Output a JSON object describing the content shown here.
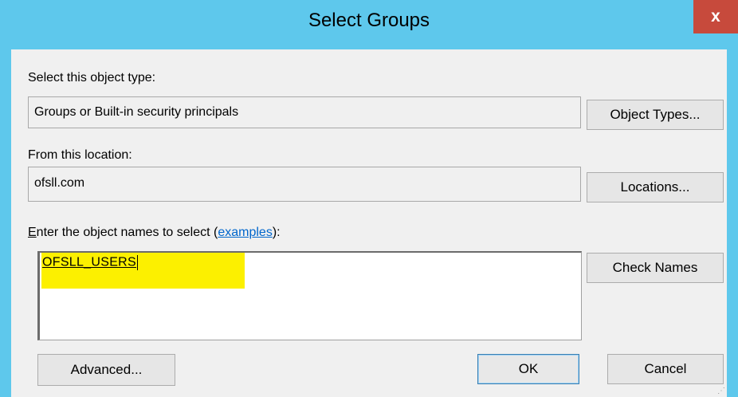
{
  "window": {
    "title": "Select Groups",
    "close_glyph": "x"
  },
  "object_type": {
    "label": "Select this object type:",
    "value": "Groups or Built-in security principals",
    "button": "Object Types..."
  },
  "location": {
    "label": "From this location:",
    "value": "ofsll.com",
    "button": "Locations..."
  },
  "names": {
    "label_prefix": "nter the object names to select (",
    "label_accel": "E",
    "link": "examples",
    "label_suffix": "):",
    "value": "OFSLL_USERS",
    "button": "Check Names"
  },
  "footer": {
    "advanced": "Advanced...",
    "ok": "OK",
    "cancel": "Cancel"
  },
  "colors": {
    "titlebar": "#5ec8ec",
    "close": "#c74a3c",
    "highlight": "#fcf000",
    "link": "#0066cc"
  }
}
